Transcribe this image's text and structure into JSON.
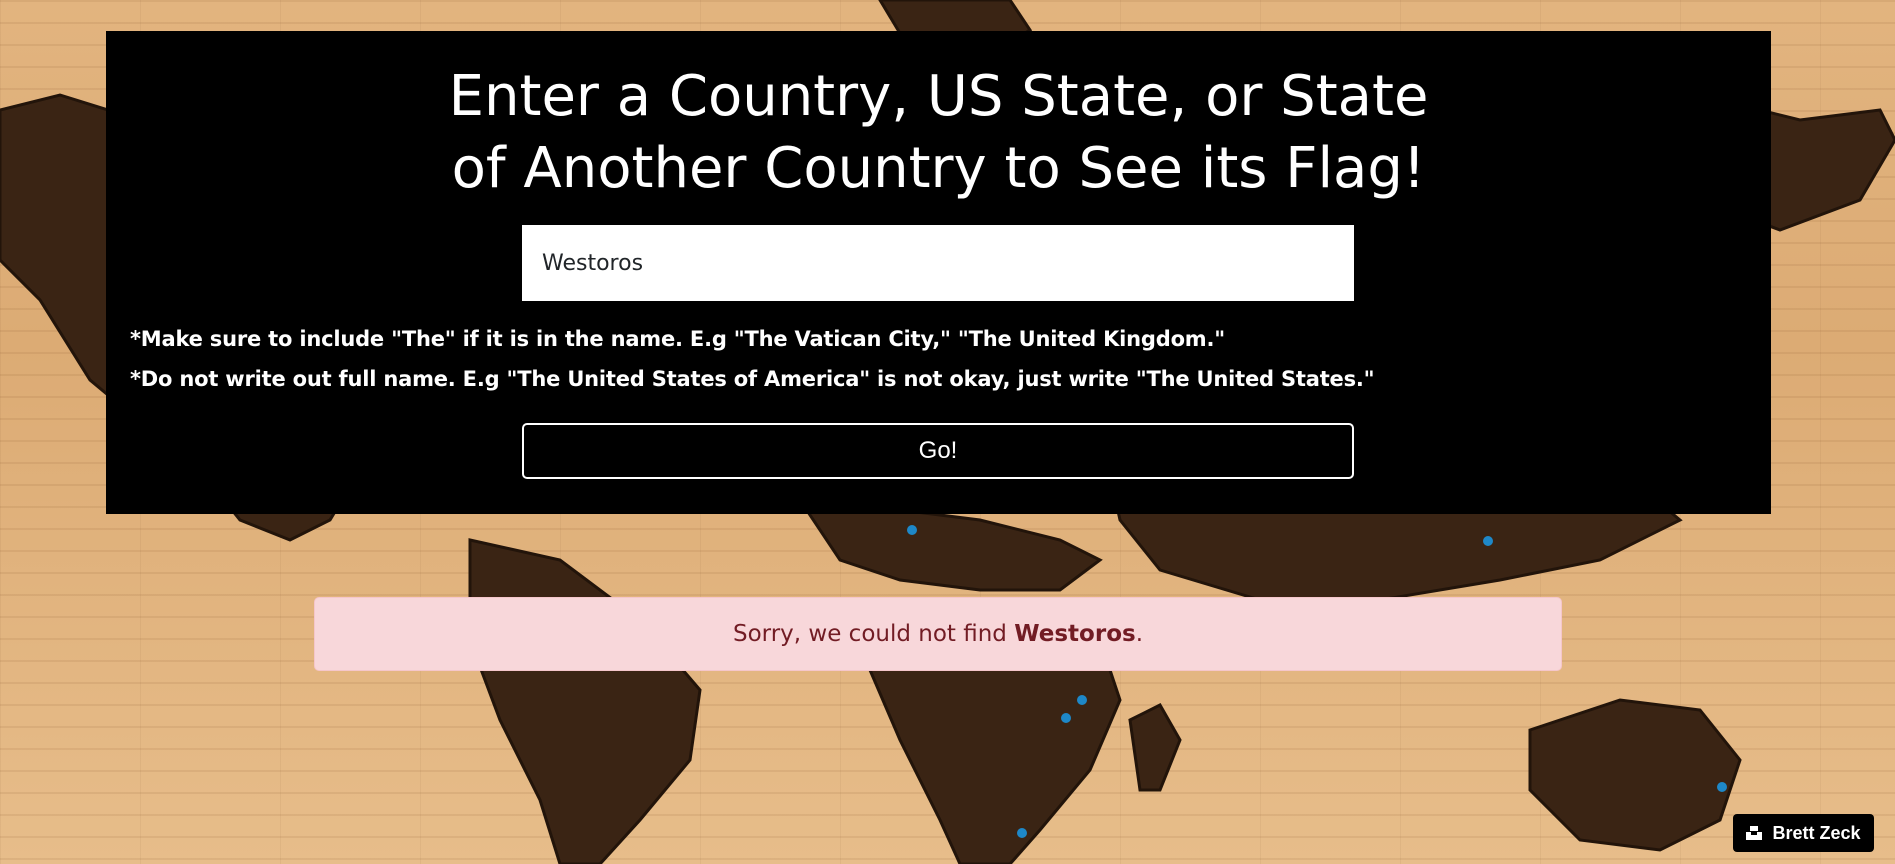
{
  "header": {
    "title_line1": "Enter a Country, US State, or State",
    "title_line2": "of Another Country to See its Flag!"
  },
  "search": {
    "value": "Westoros",
    "placeholder": ""
  },
  "notes": {
    "line1": "*Make sure to include \"The\" if it is in the name. E.g \"The Vatican City,\" \"The United Kingdom.\"",
    "line2": "*Do not write out full name. E.g \"The United States of America\" is not okay, just write \"The United States.\""
  },
  "actions": {
    "go_label": "Go!"
  },
  "alert": {
    "prefix": "Sorry, we could not find ",
    "term": "Westoros",
    "suffix": "."
  },
  "footer": {
    "author": "Brett Zeck",
    "author_icon": "unsplash-camera-icon"
  },
  "colors": {
    "card_bg": "#000000",
    "alert_bg": "#f8d7da",
    "alert_text": "#721c24"
  }
}
